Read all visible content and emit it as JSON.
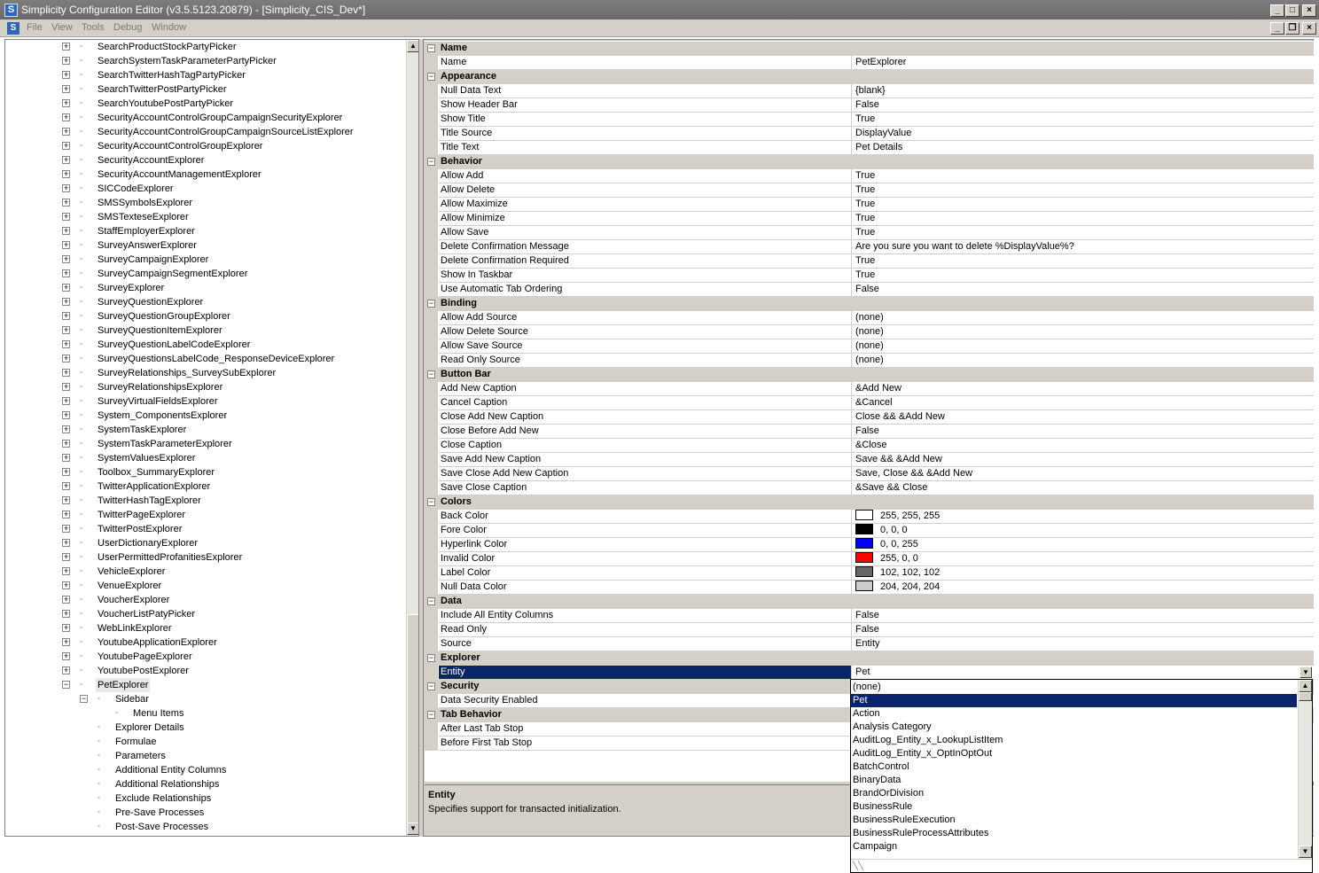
{
  "window": {
    "title": "Simplicity Configuration Editor (v3.5.5123.20879) - [Simplicity_CIS_Dev*]",
    "app_icon": "S",
    "controls": [
      "_",
      "□",
      "×"
    ],
    "mdi_controls": [
      "_",
      "❐",
      "×"
    ]
  },
  "menu": {
    "doc_icon": "S",
    "items": [
      "File",
      "View",
      "Tools",
      "Debug",
      "Window"
    ]
  },
  "tree": {
    "items": [
      {
        "label": "SearchProductStockPartyPicker",
        "level": 0,
        "expander": "+"
      },
      {
        "label": "SearchSystemTaskParameterPartyPicker",
        "level": 0,
        "expander": "+"
      },
      {
        "label": "SearchTwitterHashTagPartyPicker",
        "level": 0,
        "expander": "+"
      },
      {
        "label": "SearchTwitterPostPartyPicker",
        "level": 0,
        "expander": "+"
      },
      {
        "label": "SearchYoutubePostPartyPicker",
        "level": 0,
        "expander": "+"
      },
      {
        "label": "SecurityAccountControlGroupCampaignSecurityExplorer",
        "level": 0,
        "expander": "+"
      },
      {
        "label": "SecurityAccountControlGroupCampaignSourceListExplorer",
        "level": 0,
        "expander": "+"
      },
      {
        "label": "SecurityAccountControlGroupExplorer",
        "level": 0,
        "expander": "+"
      },
      {
        "label": "SecurityAccountExplorer",
        "level": 0,
        "expander": "+"
      },
      {
        "label": "SecurityAccountManagementExplorer",
        "level": 0,
        "expander": "+"
      },
      {
        "label": "SICCodeExplorer",
        "level": 0,
        "expander": "+"
      },
      {
        "label": "SMSSymbolsExplorer",
        "level": 0,
        "expander": "+"
      },
      {
        "label": "SMSTexteseExplorer",
        "level": 0,
        "expander": "+"
      },
      {
        "label": "StaffEmployerExplorer",
        "level": 0,
        "expander": "+"
      },
      {
        "label": "SurveyAnswerExplorer",
        "level": 0,
        "expander": "+"
      },
      {
        "label": "SurveyCampaignExplorer",
        "level": 0,
        "expander": "+"
      },
      {
        "label": "SurveyCampaignSegmentExplorer",
        "level": 0,
        "expander": "+"
      },
      {
        "label": "SurveyExplorer",
        "level": 0,
        "expander": "+"
      },
      {
        "label": "SurveyQuestionExplorer",
        "level": 0,
        "expander": "+"
      },
      {
        "label": "SurveyQuestionGroupExplorer",
        "level": 0,
        "expander": "+"
      },
      {
        "label": "SurveyQuestionItemExplorer",
        "level": 0,
        "expander": "+"
      },
      {
        "label": "SurveyQuestionLabelCodeExplorer",
        "level": 0,
        "expander": "+"
      },
      {
        "label": "SurveyQuestionsLabelCode_ResponseDeviceExplorer",
        "level": 0,
        "expander": "+"
      },
      {
        "label": "SurveyRelationships_SurveySubExplorer",
        "level": 0,
        "expander": "+"
      },
      {
        "label": "SurveyRelationshipsExplorer",
        "level": 0,
        "expander": "+"
      },
      {
        "label": "SurveyVirtualFieldsExplorer",
        "level": 0,
        "expander": "+"
      },
      {
        "label": "System_ComponentsExplorer",
        "level": 0,
        "expander": "+"
      },
      {
        "label": "SystemTaskExplorer",
        "level": 0,
        "expander": "+"
      },
      {
        "label": "SystemTaskParameterExplorer",
        "level": 0,
        "expander": "+"
      },
      {
        "label": "SystemValuesExplorer",
        "level": 0,
        "expander": "+"
      },
      {
        "label": "Toolbox_SummaryExplorer",
        "level": 0,
        "expander": "+"
      },
      {
        "label": "TwitterApplicationExplorer",
        "level": 0,
        "expander": "+"
      },
      {
        "label": "TwitterHashTagExplorer",
        "level": 0,
        "expander": "+"
      },
      {
        "label": "TwitterPageExplorer",
        "level": 0,
        "expander": "+"
      },
      {
        "label": "TwitterPostExplorer",
        "level": 0,
        "expander": "+"
      },
      {
        "label": "UserDictionaryExplorer",
        "level": 0,
        "expander": "+"
      },
      {
        "label": "UserPermittedProfanitiesExplorer",
        "level": 0,
        "expander": "+"
      },
      {
        "label": "VehicleExplorer",
        "level": 0,
        "expander": "+"
      },
      {
        "label": "VenueExplorer",
        "level": 0,
        "expander": "+"
      },
      {
        "label": "VoucherExplorer",
        "level": 0,
        "expander": "+"
      },
      {
        "label": "VoucherListPatyPicker",
        "level": 0,
        "expander": "+"
      },
      {
        "label": "WebLinkExplorer",
        "level": 0,
        "expander": "+"
      },
      {
        "label": "YoutubeApplicationExplorer",
        "level": 0,
        "expander": "+"
      },
      {
        "label": "YoutubePageExplorer",
        "level": 0,
        "expander": "+"
      },
      {
        "label": "YoutubePostExplorer",
        "level": 0,
        "expander": "+"
      },
      {
        "label": "PetExplorer",
        "level": 0,
        "expander": "−",
        "selected": true
      },
      {
        "label": "Sidebar",
        "level": 1,
        "expander": "−"
      },
      {
        "label": "Menu Items",
        "level": 2,
        "expander": ""
      },
      {
        "label": "Explorer Details",
        "level": 1,
        "expander": ""
      },
      {
        "label": "Formulae",
        "level": 1,
        "expander": ""
      },
      {
        "label": "Parameters",
        "level": 1,
        "expander": ""
      },
      {
        "label": "Additional Entity Columns",
        "level": 1,
        "expander": ""
      },
      {
        "label": "Additional Relationships",
        "level": 1,
        "expander": ""
      },
      {
        "label": "Exclude Relationships",
        "level": 1,
        "expander": ""
      },
      {
        "label": "Pre-Save Processes",
        "level": 1,
        "expander": ""
      },
      {
        "label": "Post-Save Processes",
        "level": 1,
        "expander": ""
      }
    ]
  },
  "grid": {
    "rows": [
      {
        "type": "cat",
        "name": "Name"
      },
      {
        "type": "prop",
        "name": "Name",
        "value": "PetExplorer"
      },
      {
        "type": "cat",
        "name": "Appearance"
      },
      {
        "type": "prop",
        "name": "Null Data Text",
        "value": "{blank}"
      },
      {
        "type": "prop",
        "name": "Show Header Bar",
        "value": "False"
      },
      {
        "type": "prop",
        "name": "Show Title",
        "value": "True"
      },
      {
        "type": "prop",
        "name": "Title Source",
        "value": "DisplayValue"
      },
      {
        "type": "prop",
        "name": "Title Text",
        "value": "Pet Details"
      },
      {
        "type": "cat",
        "name": "Behavior"
      },
      {
        "type": "prop",
        "name": "Allow Add",
        "value": "True"
      },
      {
        "type": "prop",
        "name": "Allow Delete",
        "value": "True"
      },
      {
        "type": "prop",
        "name": "Allow Maximize",
        "value": "True"
      },
      {
        "type": "prop",
        "name": "Allow Minimize",
        "value": "True"
      },
      {
        "type": "prop",
        "name": "Allow Save",
        "value": "True"
      },
      {
        "type": "prop",
        "name": "Delete Confirmation Message",
        "value": "Are you sure you want to delete %DisplayValue%?"
      },
      {
        "type": "prop",
        "name": "Delete Confirmation Required",
        "value": "True"
      },
      {
        "type": "prop",
        "name": "Show In Taskbar",
        "value": "True"
      },
      {
        "type": "prop",
        "name": "Use Automatic Tab Ordering",
        "value": "False"
      },
      {
        "type": "cat",
        "name": "Binding"
      },
      {
        "type": "prop",
        "name": "Allow Add Source",
        "value": "(none)"
      },
      {
        "type": "prop",
        "name": "Allow Delete Source",
        "value": "(none)"
      },
      {
        "type": "prop",
        "name": "Allow Save Source",
        "value": "(none)"
      },
      {
        "type": "prop",
        "name": "Read Only Source",
        "value": "(none)"
      },
      {
        "type": "cat",
        "name": "Button Bar"
      },
      {
        "type": "prop",
        "name": "Add New Caption",
        "value": "&Add New"
      },
      {
        "type": "prop",
        "name": "Cancel Caption",
        "value": "&Cancel"
      },
      {
        "type": "prop",
        "name": "Close Add New Caption",
        "value": "Close && &Add New"
      },
      {
        "type": "prop",
        "name": "Close Before Add New",
        "value": "False"
      },
      {
        "type": "prop",
        "name": "Close Caption",
        "value": "&Close"
      },
      {
        "type": "prop",
        "name": "Save Add New Caption",
        "value": "Save && &Add New"
      },
      {
        "type": "prop",
        "name": "Save Close Add New Caption",
        "value": "Save, Close && &Add New"
      },
      {
        "type": "prop",
        "name": "Save Close Caption",
        "value": "&Save && Close"
      },
      {
        "type": "cat",
        "name": "Colors"
      },
      {
        "type": "prop",
        "name": "Back Color",
        "value": "255, 255, 255",
        "swatch": "#ffffff"
      },
      {
        "type": "prop",
        "name": "Fore Color",
        "value": "0, 0, 0",
        "swatch": "#000000"
      },
      {
        "type": "prop",
        "name": "Hyperlink Color",
        "value": "0, 0, 255",
        "swatch": "#0000ff"
      },
      {
        "type": "prop",
        "name": "Invalid Color",
        "value": "255, 0, 0",
        "swatch": "#ff0000"
      },
      {
        "type": "prop",
        "name": "Label Color",
        "value": "102, 102, 102",
        "swatch": "#666666"
      },
      {
        "type": "prop",
        "name": "Null Data Color",
        "value": "204, 204, 204",
        "swatch": "#cccccc"
      },
      {
        "type": "cat",
        "name": "Data"
      },
      {
        "type": "prop",
        "name": "Include All Entity Columns",
        "value": "False"
      },
      {
        "type": "prop",
        "name": "Read Only",
        "value": "False"
      },
      {
        "type": "prop",
        "name": "Source",
        "value": "Entity"
      },
      {
        "type": "cat",
        "name": "Explorer"
      },
      {
        "type": "prop",
        "name": "Entity",
        "value": "Pet",
        "selected": true
      },
      {
        "type": "cat",
        "name": "Security"
      },
      {
        "type": "prop",
        "name": "Data Security Enabled",
        "value": ""
      },
      {
        "type": "cat",
        "name": "Tab Behavior"
      },
      {
        "type": "prop",
        "name": "After Last Tab Stop",
        "value": ""
      },
      {
        "type": "prop",
        "name": "Before First Tab Stop",
        "value": ""
      }
    ]
  },
  "description": {
    "title": "Entity",
    "text": "Specifies support for transacted initialization."
  },
  "dropdown": {
    "options": [
      {
        "label": "(none)"
      },
      {
        "label": "Pet",
        "selected": true
      },
      {
        "label": "Action"
      },
      {
        "label": "Analysis Category"
      },
      {
        "label": "AuditLog_Entity_x_LookupListItem"
      },
      {
        "label": "AuditLog_Entity_x_OptInOptOut"
      },
      {
        "label": "BatchControl"
      },
      {
        "label": "BinaryData"
      },
      {
        "label": "BrandOrDivision"
      },
      {
        "label": "BusinessRule"
      },
      {
        "label": "BusinessRuleExecution"
      },
      {
        "label": "BusinessRuleProcessAttributes"
      },
      {
        "label": "Campaign"
      }
    ]
  },
  "colors": {
    "selection": "#0a246a",
    "chrome": "#d4d0c8",
    "titlebar": "#7d7d7d"
  }
}
